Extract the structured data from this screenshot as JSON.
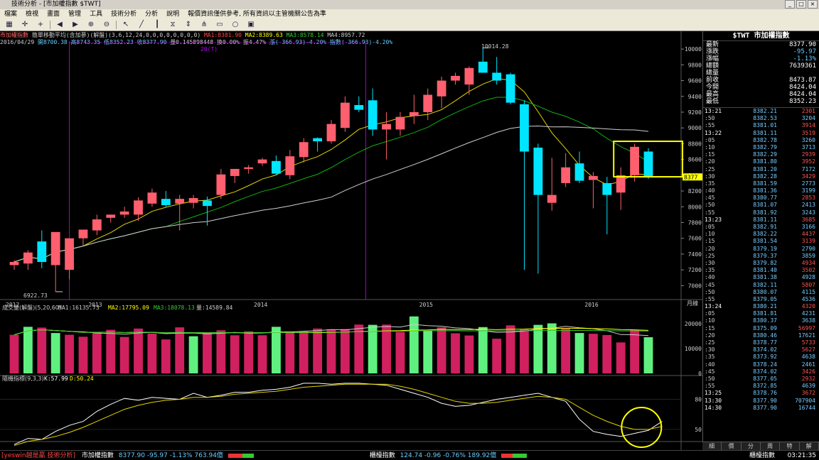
{
  "window": {
    "title": "技術分析 - [市加權指數 $TWT]"
  },
  "menu": [
    "檔案",
    "檢視",
    "畫面",
    "管理",
    "工具",
    "技術分析",
    "分析",
    "說明",
    "報價資訊僅供參考, 所有資訊以主管機關公告為準"
  ],
  "toolbar_icons": [
    "grid-icon",
    "cross-icon",
    "add-icon",
    "arrow-left-icon",
    "arrow-right-icon",
    "zoom-in-icon",
    "zoom-out-icon",
    "pointer-icon",
    "line-tool-icon",
    "bar-type-icon",
    "period-icon",
    "scale-icon",
    "fork-icon",
    "rect-icon",
    "circle-icon",
    "save-icon"
  ],
  "colors": {
    "up": "#ff5f6e",
    "down": "#00e5ff",
    "ma1": "#ffffff",
    "ma2": "#e5d300",
    "ma3": "#10b010",
    "ma4": "#cfcfcf",
    "vol_up": "#d02060",
    "vol_down": "#60f080",
    "highlight": "#ffff00",
    "k": "#ffffff",
    "d": "#e5d300"
  },
  "info": {
    "line1_name": "市加權指數",
    "line1_type": "簡單移動平均(含加蔘)(解盤)(3,6,12,24,0,0,0,0,0,0,0,0)",
    "ma1": "MA1:8381.90",
    "ma2": "MA2:8389.63",
    "ma3": "MA3:8578.14",
    "ma4": "MA4:8957.72",
    "date": "2016/04/29",
    "open": "開8700.38",
    "high": "高8743.35",
    "low": "低8352.23",
    "close": "收8377.90",
    "volume": "量0.145898448",
    "turnover": "換0.00%",
    "amp": "振4.47%",
    "change": "漲(-366.93)-4.20%",
    "change2": "指數(-366.93)-4.20%"
  },
  "chart_labels": {
    "high_marker": "10014.28",
    "low_marker": "6922.73",
    "range_marker": "20(T)",
    "period": "月線"
  },
  "volume_info": {
    "name": "成交量(解盤)(5,20,60)",
    "ma1": "MA1:16135.73",
    "ma2": "MA2:17795.09",
    "ma3": "MA3:18078.13",
    "vol": "量:14589.84"
  },
  "kd_info": {
    "name": "隨機指標(9,3,3)",
    "k": "K:57.99",
    "d": "D:50.24"
  },
  "chart_data": [
    {
      "type": "candlestick",
      "title": "市加權指數",
      "xlabel": "",
      "ylabel": "",
      "ylim": [
        6850,
        10100
      ],
      "yticks": [
        7000,
        7200,
        7400,
        7600,
        7800,
        8000,
        8200,
        8400,
        8600,
        8800,
        9000,
        9200,
        9400,
        9600,
        9800,
        10000
      ],
      "x_tick_labels": [
        {
          "i": 0,
          "label": "2012"
        },
        {
          "i": 6,
          "label": "2013"
        },
        {
          "i": 18,
          "label": "2014"
        },
        {
          "i": 30,
          "label": "2015"
        },
        {
          "i": 42,
          "label": "2016"
        }
      ],
      "candles": [
        {
          "o": 7260,
          "h": 7320,
          "l": 7200,
          "c": 7300
        },
        {
          "o": 7280,
          "h": 7450,
          "l": 7200,
          "c": 7420
        },
        {
          "o": 7560,
          "h": 7700,
          "l": 7220,
          "c": 7300
        },
        {
          "o": 7260,
          "h": 7650,
          "l": 6922.73,
          "c": 7680
        },
        {
          "o": 7200,
          "h": 7520,
          "l": 7080,
          "c": 7600
        },
        {
          "o": 7600,
          "h": 7700,
          "l": 7500,
          "c": 7710
        },
        {
          "o": 7700,
          "h": 7900,
          "l": 7640,
          "c": 7840
        },
        {
          "o": 7860,
          "h": 7900,
          "l": 7800,
          "c": 7900
        },
        {
          "o": 7900,
          "h": 8000,
          "l": 7860,
          "c": 7940
        },
        {
          "o": 7900,
          "h": 8120,
          "l": 7820,
          "c": 8080
        },
        {
          "o": 8040,
          "h": 8230,
          "l": 8000,
          "c": 8180
        },
        {
          "o": 8100,
          "h": 8200,
          "l": 8000,
          "c": 8020
        },
        {
          "o": 8040,
          "h": 8150,
          "l": 7700,
          "c": 8100
        },
        {
          "o": 8050,
          "h": 8150,
          "l": 7980,
          "c": 8110
        },
        {
          "o": 8080,
          "h": 8130,
          "l": 7760,
          "c": 8010
        },
        {
          "o": 8150,
          "h": 8480,
          "l": 8100,
          "c": 8410
        },
        {
          "o": 8390,
          "h": 8480,
          "l": 8300,
          "c": 8480
        },
        {
          "o": 8480,
          "h": 8530,
          "l": 8420,
          "c": 8500
        },
        {
          "o": 8550,
          "h": 8620,
          "l": 8520,
          "c": 8600
        },
        {
          "o": 8580,
          "h": 8650,
          "l": 8400,
          "c": 8420
        },
        {
          "o": 8400,
          "h": 8720,
          "l": 8350,
          "c": 8640
        },
        {
          "o": 8630,
          "h": 8870,
          "l": 8560,
          "c": 8820
        },
        {
          "o": 8870,
          "h": 8880,
          "l": 8700,
          "c": 8830
        },
        {
          "o": 8830,
          "h": 9100,
          "l": 8800,
          "c": 9050
        },
        {
          "o": 9000,
          "h": 9400,
          "l": 8950,
          "c": 9320
        },
        {
          "o": 9290,
          "h": 9400,
          "l": 9200,
          "c": 9230
        },
        {
          "o": 9350,
          "h": 9500,
          "l": 8900,
          "c": 8980
        },
        {
          "o": 8980,
          "h": 9200,
          "l": 8600,
          "c": 9050
        },
        {
          "o": 8980,
          "h": 9200,
          "l": 8900,
          "c": 9140
        },
        {
          "o": 9150,
          "h": 9420,
          "l": 9050,
          "c": 9200
        },
        {
          "o": 9200,
          "h": 9500,
          "l": 9100,
          "c": 9420
        },
        {
          "o": 9400,
          "h": 9650,
          "l": 9250,
          "c": 9600
        },
        {
          "o": 9600,
          "h": 9700,
          "l": 9550,
          "c": 9660
        },
        {
          "o": 9550,
          "h": 9780,
          "l": 9420,
          "c": 9760
        },
        {
          "o": 9840,
          "h": 10014.28,
          "l": 9700,
          "c": 9700
        },
        {
          "o": 9700,
          "h": 9900,
          "l": 9550,
          "c": 9600
        },
        {
          "o": 9680,
          "h": 9700,
          "l": 9300,
          "c": 9320
        },
        {
          "o": 9300,
          "h": 9350,
          "l": 7200,
          "c": 8700
        },
        {
          "o": 8750,
          "h": 8800,
          "l": 7150,
          "c": 8150
        },
        {
          "o": 8050,
          "h": 8620,
          "l": 7950,
          "c": 8150
        },
        {
          "o": 8300,
          "h": 8680,
          "l": 8250,
          "c": 8500
        },
        {
          "o": 8550,
          "h": 8700,
          "l": 8300,
          "c": 8330
        },
        {
          "o": 8340,
          "h": 8440,
          "l": 7980,
          "c": 8390
        },
        {
          "o": 8300,
          "h": 8380,
          "l": 7650,
          "c": 8150
        },
        {
          "o": 8180,
          "h": 8500,
          "l": 7960,
          "c": 8400
        },
        {
          "o": 8400,
          "h": 8800,
          "l": 8320,
          "c": 8760
        },
        {
          "o": 8700.38,
          "h": 8743.35,
          "l": 8352.23,
          "c": 8377.9
        }
      ],
      "ma_series": [
        {
          "name": "MA1",
          "key": "ma1"
        },
        {
          "name": "MA2",
          "key": "ma2"
        },
        {
          "name": "MA3",
          "key": "ma3"
        },
        {
          "name": "MA4",
          "key": "ma4"
        }
      ],
      "last_price_tag": "8377",
      "highlight_box_range": {
        "x_from": 44,
        "x_to": 46,
        "y_from": 8380,
        "y_to": 8830
      }
    },
    {
      "type": "bar",
      "title": "成交量",
      "ylim": [
        0,
        23500
      ],
      "yticks": [
        0,
        10000,
        20000
      ],
      "values": [
        15600,
        18800,
        18500,
        16300,
        15600,
        14800,
        16400,
        17600,
        14700,
        18100,
        16100,
        13700,
        18600,
        15000,
        16300,
        17400,
        15400,
        17000,
        15400,
        18800,
        17000,
        16900,
        18100,
        17800,
        17900,
        19700,
        19600,
        19700,
        16700,
        23000,
        17300,
        18600,
        16200,
        15300,
        18700,
        14000,
        19400,
        17800,
        19600,
        20200,
        18100,
        16300,
        16000,
        15500,
        12500,
        17600,
        14600
      ],
      "colors_up": [
        1,
        0,
        1,
        0,
        1,
        1,
        1,
        1,
        1,
        1,
        1,
        1,
        1,
        0,
        1,
        1,
        1,
        1,
        1,
        0,
        1,
        1,
        1,
        1,
        1,
        1,
        0,
        1,
        1,
        0,
        0,
        1,
        1,
        1,
        0,
        1,
        1,
        1,
        0,
        0,
        1,
        0,
        1,
        1,
        1,
        1,
        0
      ]
    },
    {
      "type": "line",
      "title": "隨機指標(9,3,3)",
      "ylim": [
        40,
        103
      ],
      "yticks": [
        50,
        80
      ],
      "series": [
        {
          "name": "K",
          "values": [
            35,
            41,
            40,
            48,
            54,
            58,
            68,
            75,
            81,
            79,
            82,
            81,
            80,
            86,
            82,
            84,
            87,
            87,
            89,
            90,
            92,
            96,
            96,
            95,
            96,
            96,
            95,
            94,
            90,
            86,
            82,
            76,
            73,
            74,
            77,
            80,
            82,
            84,
            86,
            82,
            78,
            60,
            48,
            45,
            43,
            46,
            49,
            58
          ]
        },
        {
          "name": "D",
          "values": [
            34,
            38,
            40,
            43,
            47,
            52,
            58,
            64,
            70,
            74,
            77,
            79,
            80,
            82,
            82,
            83,
            85,
            86,
            87,
            88,
            90,
            92,
            93,
            94,
            95,
            95,
            95,
            95,
            93,
            90,
            86,
            82,
            78,
            76,
            76,
            77,
            79,
            81,
            83,
            82,
            80,
            72,
            64,
            58,
            53,
            50,
            50,
            53
          ]
        }
      ],
      "highlight_circle": {
        "x_index": 45.5,
        "y": 52
      }
    }
  ],
  "quote": {
    "title": "$TWT 市加權指數",
    "rows": [
      {
        "label": "最新",
        "value": "8377.90"
      },
      {
        "label": "漲跌",
        "value": "-95.97"
      },
      {
        "label": "漲幅",
        "value": "-1.13%"
      },
      {
        "label": "總額",
        "value": "7639361"
      },
      {
        "label": "總量",
        "value": ""
      },
      {
        "label": "前收",
        "value": "8473.87"
      },
      {
        "label": "今開",
        "value": "8424.04"
      },
      {
        "label": "最高",
        "value": "8424.04"
      },
      {
        "label": "最低",
        "value": "8352.23"
      }
    ],
    "ticks": [
      {
        "t": "13:21",
        "p": "8382.21",
        "v": "2301"
      },
      {
        "t": ":50",
        "p": "8382.53",
        "v": "3204"
      },
      {
        "t": ":55",
        "p": "8381.01",
        "v": "3914"
      },
      {
        "t": "13:22",
        "p": "8381.11",
        "v": "3519"
      },
      {
        "t": ":05",
        "p": "8382.78",
        "v": "3260"
      },
      {
        "t": ":10",
        "p": "8382.79",
        "v": "3713"
      },
      {
        "t": ":15",
        "p": "8382.29",
        "v": "2939"
      },
      {
        "t": ":20",
        "p": "8381.80",
        "v": "3952"
      },
      {
        "t": ":25",
        "p": "8381.20",
        "v": "7172"
      },
      {
        "t": ":30",
        "p": "8382.28",
        "v": "3429"
      },
      {
        "t": ":35",
        "p": "8381.59",
        "v": "2773"
      },
      {
        "t": ":40",
        "p": "8381.36",
        "v": "3199"
      },
      {
        "t": ":45",
        "p": "8380.77",
        "v": "2853"
      },
      {
        "t": ":50",
        "p": "8381.07",
        "v": "2413"
      },
      {
        "t": ":55",
        "p": "8381.92",
        "v": "3243"
      },
      {
        "t": "13:23",
        "p": "8381.11",
        "v": "3685"
      },
      {
        "t": ":05",
        "p": "8382.91",
        "v": "3166"
      },
      {
        "t": ":10",
        "p": "8382.22",
        "v": "4437"
      },
      {
        "t": ":15",
        "p": "8381.54",
        "v": "3139"
      },
      {
        "t": ":20",
        "p": "8379.19",
        "v": "2790"
      },
      {
        "t": ":25",
        "p": "8379.37",
        "v": "3859"
      },
      {
        "t": ":30",
        "p": "8379.82",
        "v": "4934"
      },
      {
        "t": ":35",
        "p": "8381.40",
        "v": "3502"
      },
      {
        "t": ":40",
        "p": "8381.38",
        "v": "4928"
      },
      {
        "t": ":45",
        "p": "8382.11",
        "v": "5807"
      },
      {
        "t": ":50",
        "p": "8380.07",
        "v": "4115"
      },
      {
        "t": ":55",
        "p": "8379.05",
        "v": "4536"
      },
      {
        "t": "13:24",
        "p": "8380.21",
        "v": "4320"
      },
      {
        "t": ":05",
        "p": "8381.81",
        "v": "4231"
      },
      {
        "t": ":10",
        "p": "8380.37",
        "v": "3638"
      },
      {
        "t": ":15",
        "p": "8375.09",
        "v": "56997"
      },
      {
        "t": ":20",
        "p": "8380.46",
        "v": "17621"
      },
      {
        "t": ":25",
        "p": "8378.77",
        "v": "5733"
      },
      {
        "t": ":30",
        "p": "8374.02",
        "v": "5627"
      },
      {
        "t": ":35",
        "p": "8373.92",
        "v": "4638"
      },
      {
        "t": ":40",
        "p": "8378.24",
        "v": "2461"
      },
      {
        "t": ":45",
        "p": "8374.02",
        "v": "3426"
      },
      {
        "t": ":50",
        "p": "8377.05",
        "v": "2932"
      },
      {
        "t": ":55",
        "p": "8372.85",
        "v": "4639"
      },
      {
        "t": "13:25",
        "p": "8378.76",
        "v": "3672"
      },
      {
        "t": "13:30",
        "p": "8377.90",
        "v": "707904"
      },
      {
        "t": "14:30",
        "p": "8377.90",
        "v": "16744"
      }
    ],
    "tabs": [
      "細",
      "價",
      "分",
      "周",
      "特",
      "解"
    ]
  },
  "status": {
    "app": "[yeswin越是贏 技術分析]",
    "idx1_name": "市加權指數",
    "idx1_val": "8377.90 -95.97 -1.13% 763.94億",
    "idx2_name": "櫃檯指數",
    "idx2_val": "124.74 -0.96 -0.76% 189.92億",
    "right_label": "櫃檯指數",
    "time": "03:21:35"
  }
}
